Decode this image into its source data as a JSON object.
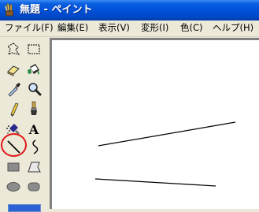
{
  "window": {
    "title": "無題 - ペイント"
  },
  "menu": {
    "items": [
      {
        "label": "ファイル(F)"
      },
      {
        "label": "編集(E)"
      },
      {
        "label": "表示(V)"
      },
      {
        "label": "変形(I)"
      },
      {
        "label": "色(C)"
      },
      {
        "label": "ヘルプ(H)"
      }
    ]
  },
  "toolbox": {
    "tools": [
      {
        "name": "free-select",
        "icon": "free-form-select-icon"
      },
      {
        "name": "rect-select",
        "icon": "rect-select-icon"
      },
      {
        "name": "eraser",
        "icon": "eraser-icon"
      },
      {
        "name": "fill",
        "icon": "fill-bucket-icon"
      },
      {
        "name": "pick-color",
        "icon": "color-picker-icon"
      },
      {
        "name": "magnifier",
        "icon": "magnifier-icon"
      },
      {
        "name": "pencil",
        "icon": "pencil-icon"
      },
      {
        "name": "brush",
        "icon": "brush-icon"
      },
      {
        "name": "airbrush",
        "icon": "airbrush-icon"
      },
      {
        "name": "text",
        "icon": "text-icon",
        "glyph": "A"
      },
      {
        "name": "line",
        "icon": "line-icon",
        "selected": true
      },
      {
        "name": "curve",
        "icon": "curve-icon"
      },
      {
        "name": "rectangle",
        "icon": "rectangle-icon"
      },
      {
        "name": "polygon",
        "icon": "polygon-icon"
      },
      {
        "name": "ellipse",
        "icon": "ellipse-icon"
      },
      {
        "name": "rounded-rectangle",
        "icon": "rounded-rectangle-icon"
      }
    ],
    "highlight_color": "#e01818"
  },
  "canvas": {
    "background": "#ffffff",
    "strokes": [
      "line",
      "line"
    ]
  },
  "colors": {
    "title_bar": "#0050d8",
    "chrome": "#ece9d8"
  }
}
